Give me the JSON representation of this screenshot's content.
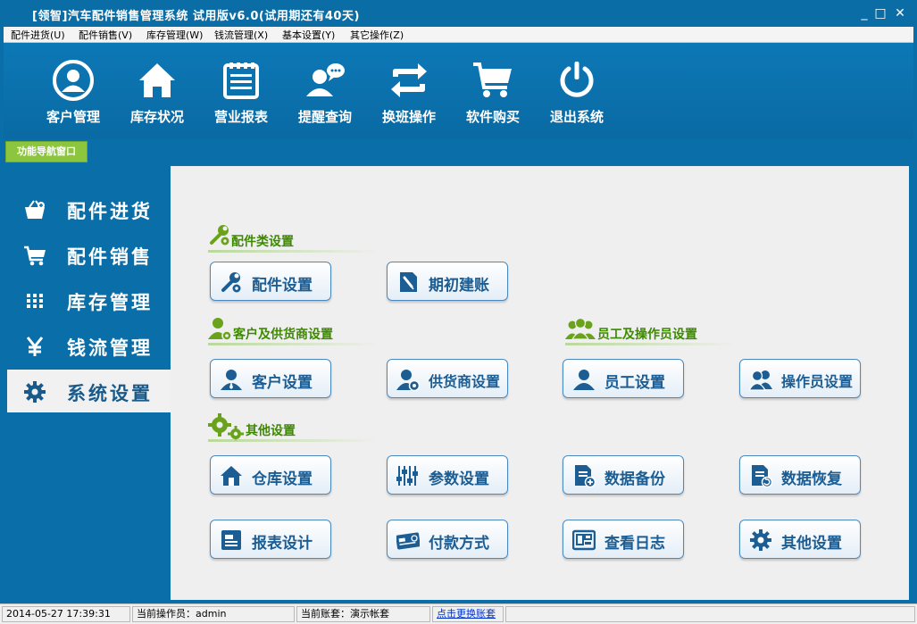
{
  "window": {
    "title": "[领智]汽车配件销售管理系统 试用版v6.0(试用期还有40天)",
    "controls": [
      "_",
      "□",
      "✕"
    ]
  },
  "menu": [
    "配件进货(U)",
    "配件销售(V)",
    "库存管理(W)",
    "钱流管理(X)",
    "基本设置(Y)",
    "其它操作(Z)"
  ],
  "toolbar": [
    {
      "label": "客户管理",
      "icon": "customer-icon"
    },
    {
      "label": "库存状况",
      "icon": "home-icon"
    },
    {
      "label": "营业报表",
      "icon": "report-icon"
    },
    {
      "label": "提醒查询",
      "icon": "reminder-icon"
    },
    {
      "label": "换班操作",
      "icon": "swap-icon"
    },
    {
      "label": "软件购买",
      "icon": "cart-icon"
    },
    {
      "label": "退出系统",
      "icon": "power-icon"
    }
  ],
  "nav_tab": "功能导航窗口",
  "sidebar": [
    {
      "label": "配件进货",
      "icon": "basket-icon"
    },
    {
      "label": "配件销售",
      "icon": "cart-icon"
    },
    {
      "label": "库存管理",
      "icon": "grid-icon"
    },
    {
      "label": "钱流管理",
      "icon": "yen-icon"
    },
    {
      "label": "系统设置",
      "icon": "gear-icon",
      "active": true
    }
  ],
  "sections": {
    "parts": {
      "title": "配件类设置",
      "buttons": [
        {
          "label": "配件设置",
          "icon": "tools-icon"
        },
        {
          "label": "期初建账",
          "icon": "ledger-icon"
        }
      ]
    },
    "customer_supplier": {
      "title": "客户及供货商设置",
      "buttons": [
        {
          "label": "客户设置",
          "icon": "person-icon"
        },
        {
          "label": "供货商设置",
          "icon": "person-gear-icon"
        }
      ]
    },
    "staff": {
      "title": "员工及操作员设置",
      "buttons": [
        {
          "label": "员工设置",
          "icon": "person-icon"
        },
        {
          "label": "操作员设置",
          "icon": "people-icon"
        }
      ]
    },
    "other": {
      "title": "其他设置",
      "buttons": [
        {
          "label": "仓库设置",
          "icon": "warehouse-icon"
        },
        {
          "label": "参数设置",
          "icon": "sliders-icon"
        },
        {
          "label": "数据备份",
          "icon": "backup-icon"
        },
        {
          "label": "数据恢复",
          "icon": "restore-icon"
        },
        {
          "label": "报表设计",
          "icon": "report-design-icon"
        },
        {
          "label": "付款方式",
          "icon": "card-icon"
        },
        {
          "label": "查看日志",
          "icon": "log-icon"
        },
        {
          "label": "其他设置",
          "icon": "gear-icon"
        }
      ]
    }
  },
  "status": {
    "datetime": "2014-05-27 17:39:31",
    "operator": "当前操作员：admin",
    "account": "当前账套：演示帐套",
    "switch_link": "点击更换账套"
  },
  "colors": {
    "primary": "#0a6fa8",
    "accent_green": "#8cc63f",
    "button_text": "#1c5d93"
  }
}
